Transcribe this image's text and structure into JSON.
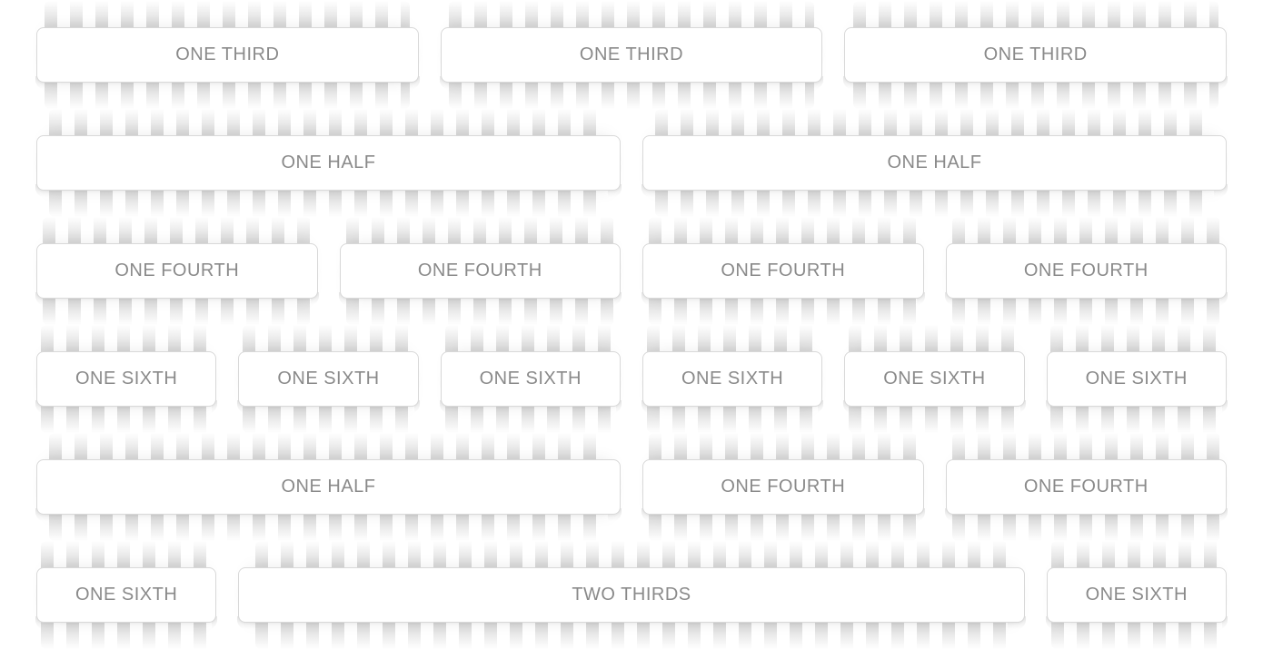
{
  "rows": [
    {
      "cols": [
        {
          "label": "ONE THIRD",
          "width": "w-1-3"
        },
        {
          "label": "ONE THIRD",
          "width": "w-1-3"
        },
        {
          "label": "ONE THIRD",
          "width": "w-1-3"
        }
      ]
    },
    {
      "cols": [
        {
          "label": "ONE HALF",
          "width": "w-1-2"
        },
        {
          "label": "ONE HALF",
          "width": "w-1-2"
        }
      ]
    },
    {
      "cols": [
        {
          "label": "ONE FOURTH",
          "width": "w-1-4"
        },
        {
          "label": "ONE FOURTH",
          "width": "w-1-4"
        },
        {
          "label": "ONE FOURTH",
          "width": "w-1-4"
        },
        {
          "label": "ONE FOURTH",
          "width": "w-1-4"
        }
      ]
    },
    {
      "cols": [
        {
          "label": "ONE SIXTH",
          "width": "w-1-6"
        },
        {
          "label": "ONE SIXTH",
          "width": "w-1-6"
        },
        {
          "label": "ONE SIXTH",
          "width": "w-1-6"
        },
        {
          "label": "ONE SIXTH",
          "width": "w-1-6"
        },
        {
          "label": "ONE SIXTH",
          "width": "w-1-6"
        },
        {
          "label": "ONE SIXTH",
          "width": "w-1-6"
        }
      ]
    },
    {
      "cols": [
        {
          "label": "ONE HALF",
          "width": "w-1-2"
        },
        {
          "label": "ONE FOURTH",
          "width": "w-1-4"
        },
        {
          "label": "ONE FOURTH",
          "width": "w-1-4"
        }
      ]
    },
    {
      "cols": [
        {
          "label": "ONE SIXTH",
          "width": "w-1-6"
        },
        {
          "label": "TWO THIRDS",
          "width": "w-2-3"
        },
        {
          "label": "ONE SIXTH",
          "width": "w-1-6"
        }
      ]
    }
  ]
}
